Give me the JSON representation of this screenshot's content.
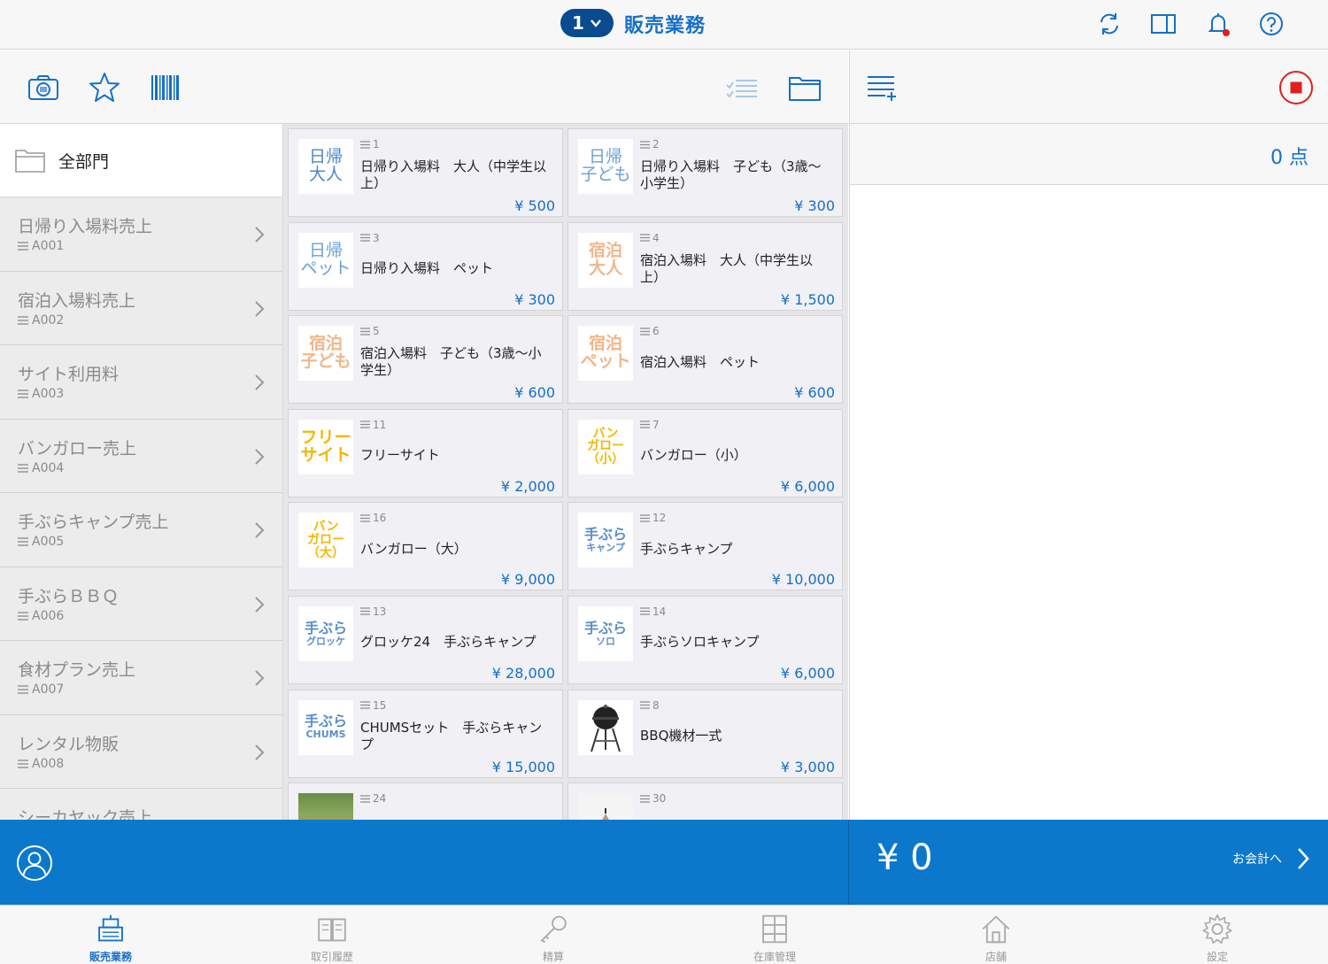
{
  "header": {
    "register_number": "1",
    "title": "販売業務"
  },
  "sidebar": {
    "all_label": "全部門",
    "items": [
      {
        "label": "日帰り入場料売上",
        "code": "A001"
      },
      {
        "label": "宿泊入場料売上",
        "code": "A002"
      },
      {
        "label": "サイト利用料",
        "code": "A003"
      },
      {
        "label": "バンガロー売上",
        "code": "A004"
      },
      {
        "label": "手ぶらキャンプ売上",
        "code": "A005"
      },
      {
        "label": "手ぶらＢＢＱ",
        "code": "A006"
      },
      {
        "label": "食材プラン売上",
        "code": "A007"
      },
      {
        "label": "レンタル物販",
        "code": "A008"
      },
      {
        "label": "シーカヤック売上",
        "code": ""
      }
    ]
  },
  "products": [
    {
      "no": "1",
      "name": "日帰り入場料　大人（中学生以上）",
      "price": "¥ 500",
      "thumb": [
        "日帰",
        "大人"
      ],
      "thumb_color": "#4a88c8",
      "thumb_style": "plain"
    },
    {
      "no": "2",
      "name": "日帰り入場料　子ども（3歳〜小学生）",
      "price": "¥ 300",
      "thumb": [
        "日帰",
        "子ども"
      ],
      "thumb_color": "#6aa0d4",
      "thumb_style": "plain"
    },
    {
      "no": "3",
      "name": "日帰り入場料　ペット",
      "price": "¥ 300",
      "thumb": [
        "日帰",
        "ペット"
      ],
      "thumb_color": "#6aa0d4",
      "thumb_style": "plain"
    },
    {
      "no": "4",
      "name": "宿泊入場料　大人（中学生以上）",
      "price": "¥ 1,500",
      "thumb": [
        "宿泊",
        "大人"
      ],
      "thumb_color": "#f0b78a",
      "thumb_style": "bold"
    },
    {
      "no": "5",
      "name": "宿泊入場料　子ども（3歳〜小学生）",
      "price": "¥ 600",
      "thumb": [
        "宿泊",
        "子ども"
      ],
      "thumb_color": "#f0b78a",
      "thumb_style": "bold"
    },
    {
      "no": "6",
      "name": "宿泊入場料　ペット",
      "price": "¥ 600",
      "thumb": [
        "宿泊",
        "ペット"
      ],
      "thumb_color": "#f0b78a",
      "thumb_style": "bold"
    },
    {
      "no": "11",
      "name": "フリーサイト",
      "price": "¥ 2,000",
      "thumb": [
        "フリー",
        "サイト"
      ],
      "thumb_color": "#f2b800",
      "thumb_style": "bold"
    },
    {
      "no": "7",
      "name": "バンガロー（小）",
      "price": "¥ 6,000",
      "thumb": [
        "バン",
        "ガロー",
        "（小）"
      ],
      "thumb_color": "#f2b800",
      "thumb_style": "three"
    },
    {
      "no": "16",
      "name": "バンガロー（大）",
      "price": "¥ 9,000",
      "thumb": [
        "バン",
        "ガロー",
        "（大）"
      ],
      "thumb_color": "#f2b800",
      "thumb_style": "three"
    },
    {
      "no": "12",
      "name": "手ぶらキャンプ",
      "price": "¥ 10,000",
      "thumb": [
        "手ぶら",
        "キャンプ"
      ],
      "thumb_color": "#5a8fc8",
      "thumb_style": "small"
    },
    {
      "no": "13",
      "name": "グロッケ24　手ぶらキャンプ",
      "price": "¥ 28,000",
      "thumb": [
        "手ぶら",
        "グロッケ"
      ],
      "thumb_color": "#5a8fc8",
      "thumb_style": "small"
    },
    {
      "no": "14",
      "name": "手ぶらソロキャンプ",
      "price": "¥ 6,000",
      "thumb": [
        "手ぶら",
        "ソロ"
      ],
      "thumb_color": "#5a8fc8",
      "thumb_style": "small"
    },
    {
      "no": "15",
      "name": "CHUMSセット　手ぶらキャンプ",
      "price": "¥ 15,000",
      "thumb": [
        "手ぶら",
        "CHUMS"
      ],
      "thumb_color": "#5a8fc8",
      "thumb_style": "small"
    },
    {
      "no": "8",
      "name": "BBQ機材一式",
      "price": "¥ 3,000",
      "thumb": [],
      "thumb_color": "#222222",
      "thumb_style": "grill"
    },
    {
      "no": "24",
      "name": "",
      "price": "",
      "thumb": [],
      "thumb_color": "#7a9a5a",
      "thumb_style": "photo-fire"
    },
    {
      "no": "30",
      "name": "",
      "price": "",
      "thumb": [],
      "thumb_color": "#8a8060",
      "thumb_style": "photo-tent"
    }
  ],
  "cart": {
    "count": "0 点"
  },
  "actionbar": {
    "total": "¥ 0",
    "checkout_label": "お会計へ"
  },
  "tabs": [
    {
      "label": "販売業務",
      "icon": "register-icon",
      "active": true
    },
    {
      "label": "取引履歴",
      "icon": "book-icon",
      "active": false
    },
    {
      "label": "精算",
      "icon": "key-icon",
      "active": false
    },
    {
      "label": "在庫管理",
      "icon": "inventory-icon",
      "active": false
    },
    {
      "label": "店舗",
      "icon": "home-icon",
      "active": false
    },
    {
      "label": "設定",
      "icon": "gear-icon",
      "active": false
    }
  ],
  "colors": {
    "accent": "#1670c6",
    "action_bar": "#0b78cc",
    "register_pill": "#0a4a8f",
    "stop_red": "#e02020"
  }
}
